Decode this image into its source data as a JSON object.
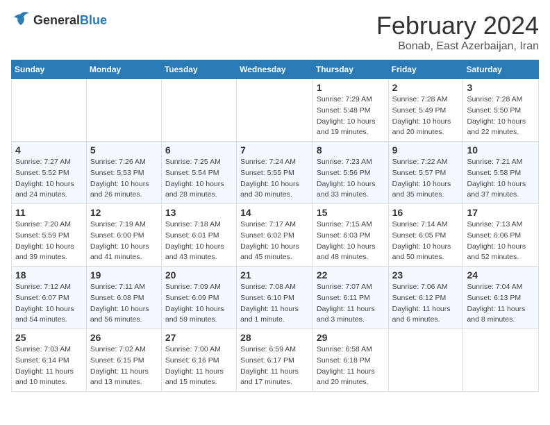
{
  "header": {
    "logo_general": "General",
    "logo_blue": "Blue",
    "title": "February 2024",
    "subtitle": "Bonab, East Azerbaijan, Iran"
  },
  "calendar": {
    "days_of_week": [
      "Sunday",
      "Monday",
      "Tuesday",
      "Wednesday",
      "Thursday",
      "Friday",
      "Saturday"
    ],
    "weeks": [
      [
        {
          "day": "",
          "info": ""
        },
        {
          "day": "",
          "info": ""
        },
        {
          "day": "",
          "info": ""
        },
        {
          "day": "",
          "info": ""
        },
        {
          "day": "1",
          "info": "Sunrise: 7:29 AM\nSunset: 5:48 PM\nDaylight: 10 hours and 19 minutes."
        },
        {
          "day": "2",
          "info": "Sunrise: 7:28 AM\nSunset: 5:49 PM\nDaylight: 10 hours and 20 minutes."
        },
        {
          "day": "3",
          "info": "Sunrise: 7:28 AM\nSunset: 5:50 PM\nDaylight: 10 hours and 22 minutes."
        }
      ],
      [
        {
          "day": "4",
          "info": "Sunrise: 7:27 AM\nSunset: 5:52 PM\nDaylight: 10 hours and 24 minutes."
        },
        {
          "day": "5",
          "info": "Sunrise: 7:26 AM\nSunset: 5:53 PM\nDaylight: 10 hours and 26 minutes."
        },
        {
          "day": "6",
          "info": "Sunrise: 7:25 AM\nSunset: 5:54 PM\nDaylight: 10 hours and 28 minutes."
        },
        {
          "day": "7",
          "info": "Sunrise: 7:24 AM\nSunset: 5:55 PM\nDaylight: 10 hours and 30 minutes."
        },
        {
          "day": "8",
          "info": "Sunrise: 7:23 AM\nSunset: 5:56 PM\nDaylight: 10 hours and 33 minutes."
        },
        {
          "day": "9",
          "info": "Sunrise: 7:22 AM\nSunset: 5:57 PM\nDaylight: 10 hours and 35 minutes."
        },
        {
          "day": "10",
          "info": "Sunrise: 7:21 AM\nSunset: 5:58 PM\nDaylight: 10 hours and 37 minutes."
        }
      ],
      [
        {
          "day": "11",
          "info": "Sunrise: 7:20 AM\nSunset: 5:59 PM\nDaylight: 10 hours and 39 minutes."
        },
        {
          "day": "12",
          "info": "Sunrise: 7:19 AM\nSunset: 6:00 PM\nDaylight: 10 hours and 41 minutes."
        },
        {
          "day": "13",
          "info": "Sunrise: 7:18 AM\nSunset: 6:01 PM\nDaylight: 10 hours and 43 minutes."
        },
        {
          "day": "14",
          "info": "Sunrise: 7:17 AM\nSunset: 6:02 PM\nDaylight: 10 hours and 45 minutes."
        },
        {
          "day": "15",
          "info": "Sunrise: 7:15 AM\nSunset: 6:03 PM\nDaylight: 10 hours and 48 minutes."
        },
        {
          "day": "16",
          "info": "Sunrise: 7:14 AM\nSunset: 6:05 PM\nDaylight: 10 hours and 50 minutes."
        },
        {
          "day": "17",
          "info": "Sunrise: 7:13 AM\nSunset: 6:06 PM\nDaylight: 10 hours and 52 minutes."
        }
      ],
      [
        {
          "day": "18",
          "info": "Sunrise: 7:12 AM\nSunset: 6:07 PM\nDaylight: 10 hours and 54 minutes."
        },
        {
          "day": "19",
          "info": "Sunrise: 7:11 AM\nSunset: 6:08 PM\nDaylight: 10 hours and 56 minutes."
        },
        {
          "day": "20",
          "info": "Sunrise: 7:09 AM\nSunset: 6:09 PM\nDaylight: 10 hours and 59 minutes."
        },
        {
          "day": "21",
          "info": "Sunrise: 7:08 AM\nSunset: 6:10 PM\nDaylight: 11 hours and 1 minute."
        },
        {
          "day": "22",
          "info": "Sunrise: 7:07 AM\nSunset: 6:11 PM\nDaylight: 11 hours and 3 minutes."
        },
        {
          "day": "23",
          "info": "Sunrise: 7:06 AM\nSunset: 6:12 PM\nDaylight: 11 hours and 6 minutes."
        },
        {
          "day": "24",
          "info": "Sunrise: 7:04 AM\nSunset: 6:13 PM\nDaylight: 11 hours and 8 minutes."
        }
      ],
      [
        {
          "day": "25",
          "info": "Sunrise: 7:03 AM\nSunset: 6:14 PM\nDaylight: 11 hours and 10 minutes."
        },
        {
          "day": "26",
          "info": "Sunrise: 7:02 AM\nSunset: 6:15 PM\nDaylight: 11 hours and 13 minutes."
        },
        {
          "day": "27",
          "info": "Sunrise: 7:00 AM\nSunset: 6:16 PM\nDaylight: 11 hours and 15 minutes."
        },
        {
          "day": "28",
          "info": "Sunrise: 6:59 AM\nSunset: 6:17 PM\nDaylight: 11 hours and 17 minutes."
        },
        {
          "day": "29",
          "info": "Sunrise: 6:58 AM\nSunset: 6:18 PM\nDaylight: 11 hours and 20 minutes."
        },
        {
          "day": "",
          "info": ""
        },
        {
          "day": "",
          "info": ""
        }
      ]
    ]
  }
}
